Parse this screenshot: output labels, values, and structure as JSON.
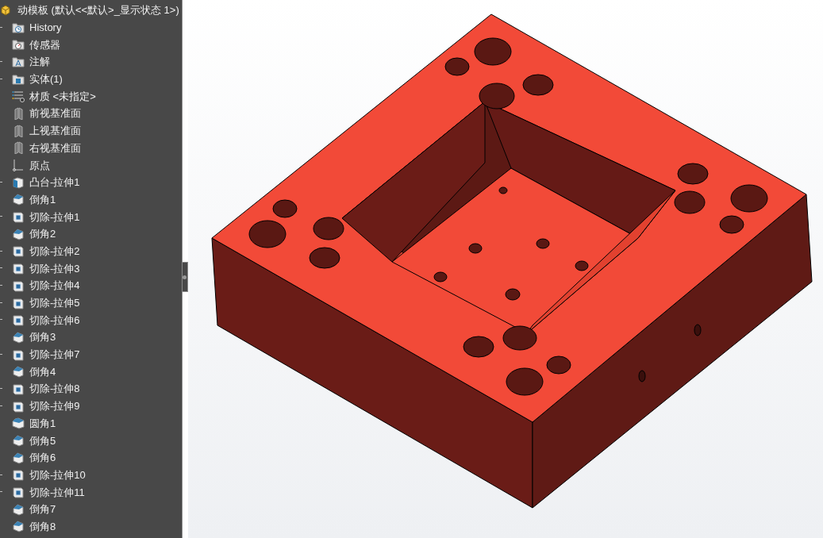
{
  "tree": {
    "root": {
      "label": "动模板 (默认<<默认>_显示状态 1>)"
    },
    "items": [
      {
        "kind": "history",
        "label": "History",
        "expandable": true
      },
      {
        "kind": "sensor",
        "label": "传感器",
        "expandable": false
      },
      {
        "kind": "annotation",
        "label": "注解",
        "expandable": true
      },
      {
        "kind": "solid",
        "label": "实体(1)",
        "expandable": true
      },
      {
        "kind": "material",
        "label": "材质 <未指定>",
        "expandable": false
      },
      {
        "kind": "plane",
        "label": "前视基准面",
        "expandable": false
      },
      {
        "kind": "plane",
        "label": "上视基准面",
        "expandable": false
      },
      {
        "kind": "plane",
        "label": "右视基准面",
        "expandable": false
      },
      {
        "kind": "origin",
        "label": "原点",
        "expandable": false
      },
      {
        "kind": "boss",
        "label": "凸台-拉伸1",
        "expandable": true
      },
      {
        "kind": "chamfer",
        "label": "倒角1",
        "expandable": false
      },
      {
        "kind": "cut",
        "label": "切除-拉伸1",
        "expandable": true
      },
      {
        "kind": "chamfer",
        "label": "倒角2",
        "expandable": false
      },
      {
        "kind": "cut",
        "label": "切除-拉伸2",
        "expandable": true
      },
      {
        "kind": "cut",
        "label": "切除-拉伸3",
        "expandable": true
      },
      {
        "kind": "cut",
        "label": "切除-拉伸4",
        "expandable": true
      },
      {
        "kind": "cut",
        "label": "切除-拉伸5",
        "expandable": true
      },
      {
        "kind": "cut",
        "label": "切除-拉伸6",
        "expandable": true
      },
      {
        "kind": "chamfer",
        "label": "倒角3",
        "expandable": false
      },
      {
        "kind": "cut",
        "label": "切除-拉伸7",
        "expandable": true
      },
      {
        "kind": "chamfer",
        "label": "倒角4",
        "expandable": false
      },
      {
        "kind": "cut",
        "label": "切除-拉伸8",
        "expandable": true
      },
      {
        "kind": "cut",
        "label": "切除-拉伸9",
        "expandable": true
      },
      {
        "kind": "fillet",
        "label": "圆角1",
        "expandable": false
      },
      {
        "kind": "chamfer",
        "label": "倒角5",
        "expandable": false
      },
      {
        "kind": "chamfer",
        "label": "倒角6",
        "expandable": false
      },
      {
        "kind": "cut",
        "label": "切除-拉伸10",
        "expandable": true
      },
      {
        "kind": "cut",
        "label": "切除-拉伸11",
        "expandable": true
      },
      {
        "kind": "chamfer",
        "label": "倒角7",
        "expandable": false
      },
      {
        "kind": "chamfer",
        "label": "倒角8",
        "expandable": false
      }
    ]
  }
}
